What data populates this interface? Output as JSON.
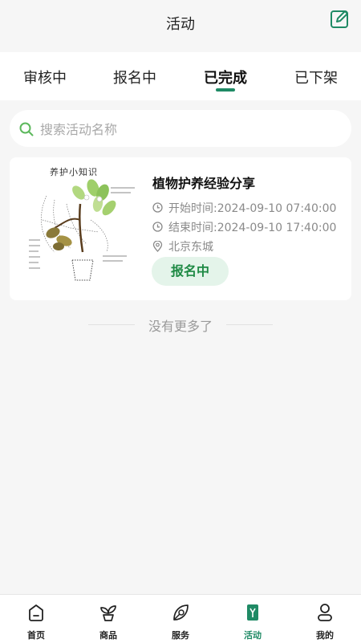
{
  "header": {
    "title": "活动",
    "edit_icon": "edit-icon"
  },
  "tabs": [
    {
      "label": "审核中",
      "active": false
    },
    {
      "label": "报名中",
      "active": false
    },
    {
      "label": "已完成",
      "active": true
    },
    {
      "label": "已下架",
      "active": false
    }
  ],
  "search": {
    "placeholder": "搜索活动名称",
    "value": "",
    "icon": "search-icon"
  },
  "activities": [
    {
      "title": "植物护养经验分享",
      "thumb_text": "养护小知识",
      "start": "开始时间:2024-09-10 07:40:00",
      "end": "结束时间:2024-09-10 17:40:00",
      "location": "北京东城",
      "status": "报名中"
    }
  ],
  "list_end": "没有更多了",
  "bottom_nav": [
    {
      "label": "首页",
      "icon": "home-icon",
      "active": false
    },
    {
      "label": "商品",
      "icon": "plant-icon",
      "active": false
    },
    {
      "label": "服务",
      "icon": "leaf-service-icon",
      "active": false
    },
    {
      "label": "活动",
      "icon": "activity-icon",
      "active": true
    },
    {
      "label": "我的",
      "icon": "profile-icon",
      "active": false
    }
  ],
  "colors": {
    "accent": "#1f8a65",
    "badge_bg": "#e4f4ea",
    "badge_text": "#1f8a45",
    "background": "#f6f6f6"
  }
}
